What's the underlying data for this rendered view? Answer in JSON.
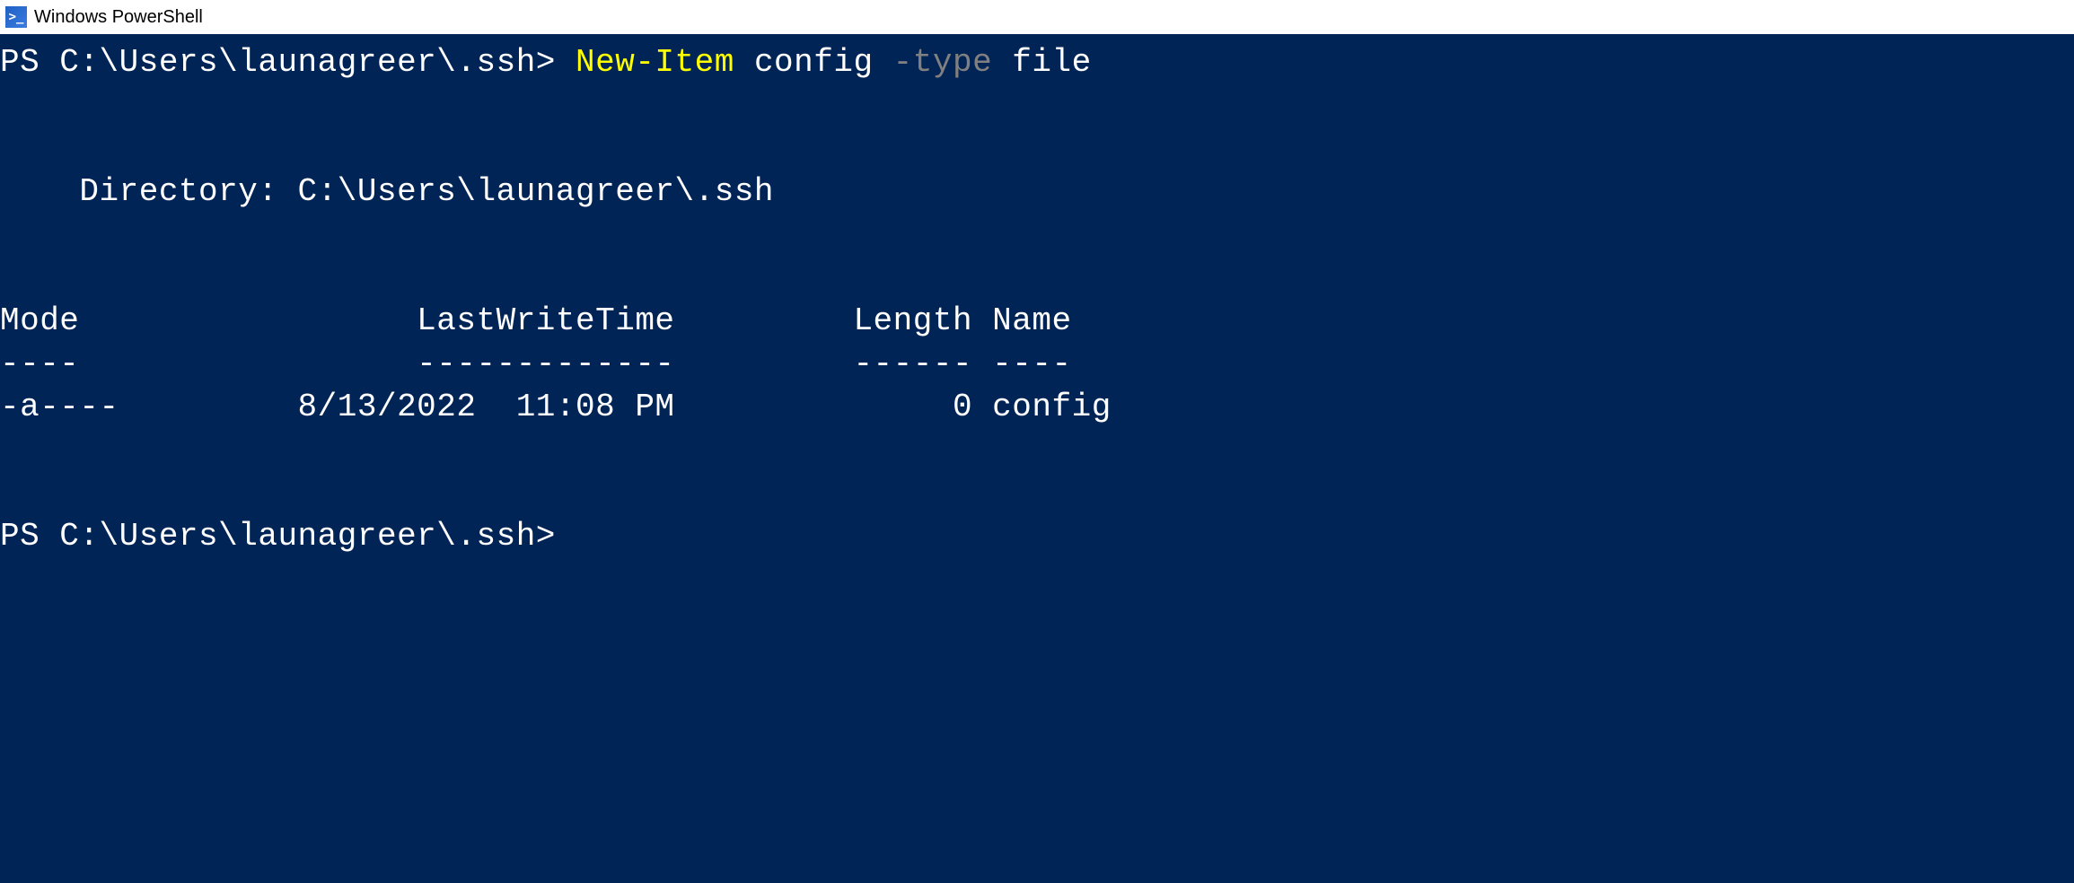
{
  "window": {
    "title": "Windows PowerShell",
    "icon_text": ">_"
  },
  "terminal": {
    "line1": {
      "prompt": "PS C:\\Users\\launagreer\\.ssh> ",
      "cmdlet": "New-Item",
      "arg1": " config ",
      "param": "-type",
      "arg2": " file"
    },
    "blank": "",
    "directory_line": "    Directory: C:\\Users\\launagreer\\.ssh",
    "header_line": "Mode                 LastWriteTime         Length Name",
    "divider_line": "----                 -------------         ------ ----",
    "data_line": "-a----         8/13/2022  11:08 PM              0 config",
    "prompt2": "PS C:\\Users\\launagreer\\.ssh>"
  }
}
